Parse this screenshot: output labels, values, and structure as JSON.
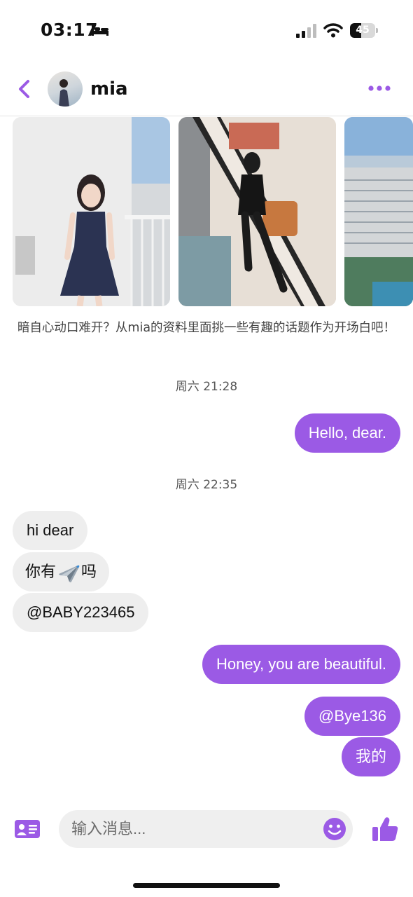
{
  "status_bar": {
    "time": "03:17",
    "battery_level": "45",
    "battery_fraction": 0.45,
    "icons": [
      "bed-icon",
      "signal-icon",
      "wifi-icon",
      "battery-icon"
    ]
  },
  "header": {
    "contact_name": "mia",
    "icons": [
      "back-icon",
      "avatar",
      "more-icon"
    ]
  },
  "accent_color": "#9b5ae5",
  "photos": [
    {
      "subject": "profile-photo-1"
    },
    {
      "subject": "profile-photo-2"
    },
    {
      "subject": "profile-photo-3"
    }
  ],
  "hint": "暗自心动口难开？从mia的资料里面挑一些有趣的话题作为开场白吧！",
  "conversation": {
    "timestamp_1": "周六 21:28",
    "msg_1": "Hello, dear.",
    "timestamp_2": "周六 22:35",
    "msg_2": "hi dear",
    "msg_3_before": "你有",
    "msg_3_emoji": "airplane-emoji",
    "msg_3_after": "吗",
    "msg_4": "@BABY223465",
    "msg_5": "Honey, you are beautiful.",
    "msg_6": "@Bye136",
    "msg_7": "我的"
  },
  "composer": {
    "placeholder": "输入消息...",
    "icons": [
      "contact-card-icon",
      "emoji-icon",
      "like-icon"
    ]
  }
}
